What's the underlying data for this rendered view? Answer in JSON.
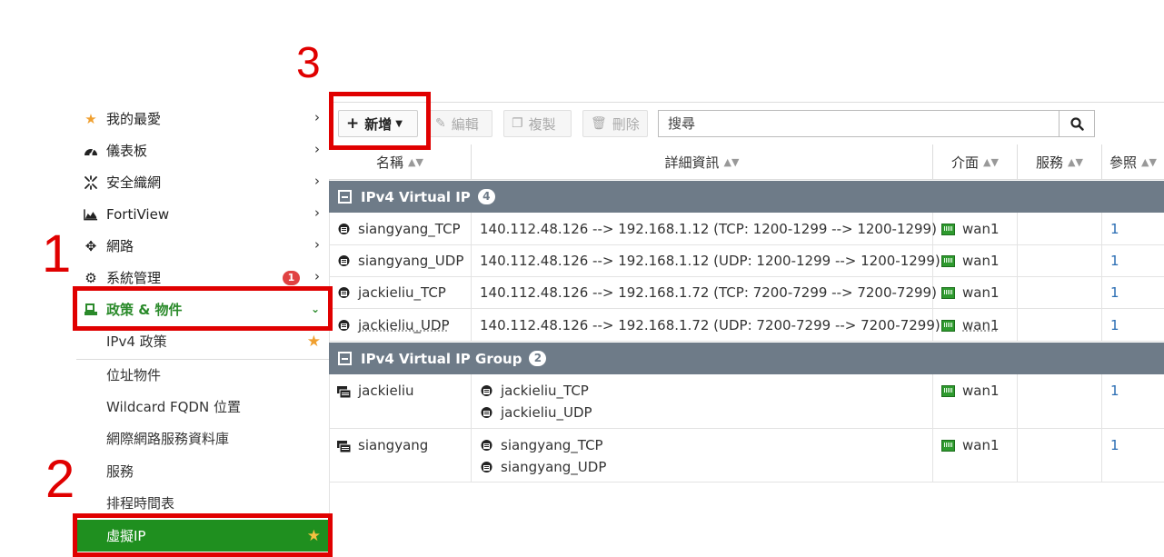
{
  "annotations": {
    "one": "1",
    "two": "2",
    "three": "3"
  },
  "sidebar": {
    "items": [
      {
        "label": "我的最愛",
        "icon": "star-icon"
      },
      {
        "label": "儀表板",
        "icon": "dashboard-icon"
      },
      {
        "label": "安全織網",
        "icon": "security-fabric-icon"
      },
      {
        "label": "FortiView",
        "icon": "chart-icon"
      },
      {
        "label": "網路",
        "icon": "network-move-icon"
      },
      {
        "label": "系統管理",
        "icon": "gear-icon",
        "badge": "1"
      },
      {
        "label": "政策 & 物件",
        "icon": "policy-icon"
      }
    ],
    "sub_items": [
      {
        "label": "IPv4 政策"
      },
      {
        "label": "位址物件"
      },
      {
        "label": "Wildcard FQDN 位置"
      },
      {
        "label": "網際網路服務資料庫"
      },
      {
        "label": "服務"
      },
      {
        "label": "排程時間表"
      },
      {
        "label": "虛擬IP"
      }
    ]
  },
  "toolbar": {
    "new_label": "新增",
    "edit_label": "編輯",
    "clone_label": "複製",
    "delete_label": "刪除",
    "search_placeholder": "搜尋"
  },
  "table": {
    "columns": [
      "名稱",
      "詳細資訊",
      "介面",
      "服務",
      "參照"
    ],
    "groups": [
      {
        "title": "IPv4 Virtual IP",
        "count": "4",
        "rows": [
          {
            "name": "siangyang_TCP",
            "detail": "140.112.48.126 --> 192.168.1.12 (TCP: 1200-1299 --> 1200-1299)",
            "interface": "wan1",
            "service": "",
            "ref": "1"
          },
          {
            "name": "siangyang_UDP",
            "detail": "140.112.48.126 --> 192.168.1.12 (UDP: 1200-1299 --> 1200-1299)",
            "interface": "wan1",
            "service": "",
            "ref": "1"
          },
          {
            "name": "jackieliu_TCP",
            "detail": "140.112.48.126 --> 192.168.1.72 (TCP: 7200-7299 --> 7200-7299)",
            "interface": "wan1",
            "service": "",
            "ref": "1"
          },
          {
            "name": "jackieliu_UDP",
            "detail": "140.112.48.126 --> 192.168.1.72 (UDP: 7200-7299 --> 7200-7299)",
            "interface": "wan1",
            "service": "",
            "ref": "1"
          }
        ]
      },
      {
        "title": "IPv4 Virtual IP Group",
        "count": "2",
        "rows": [
          {
            "name": "jackieliu",
            "members": [
              "jackieliu_TCP",
              "jackieliu_UDP"
            ],
            "interface": "wan1",
            "service": "",
            "ref": "1"
          },
          {
            "name": "siangyang",
            "members": [
              "siangyang_TCP",
              "siangyang_UDP"
            ],
            "interface": "wan1",
            "service": "",
            "ref": "1"
          }
        ]
      }
    ]
  },
  "colors": {
    "active_green": "#1f8f1f",
    "highlight_red": "#e00000",
    "group_header": "#6e7b88",
    "link_blue": "#2a6db3"
  }
}
